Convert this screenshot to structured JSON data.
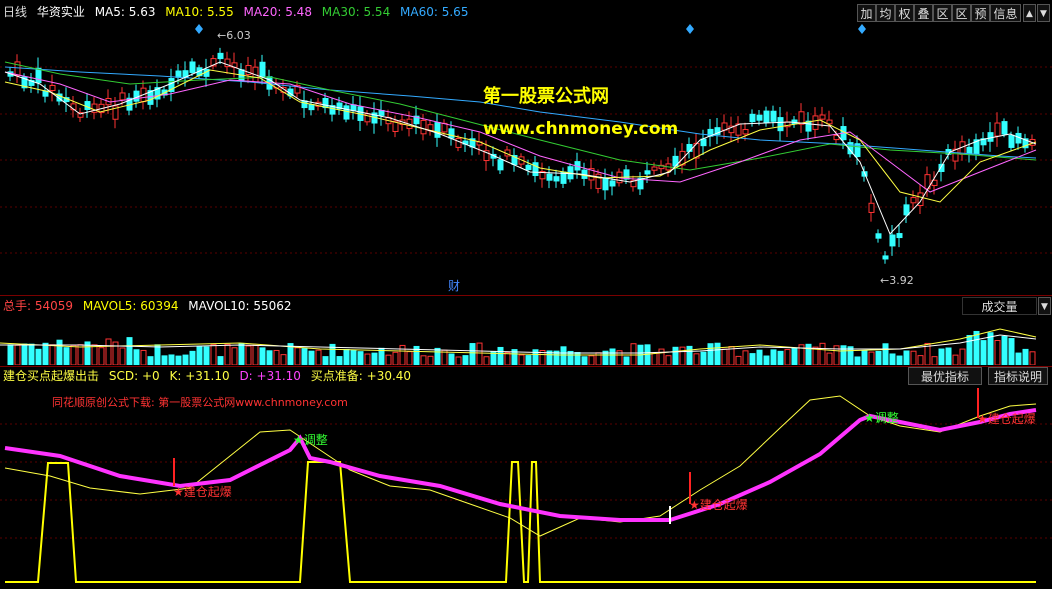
{
  "price_header": {
    "period": "日线",
    "stock": "华资实业",
    "ma5": "MA5: 5.63",
    "ma10": "MA10: 5.55",
    "ma20": "MA20: 5.48",
    "ma30": "MA30: 5.54",
    "ma60": "MA60: 5.65"
  },
  "toolbar": [
    "加",
    "均",
    "权",
    "叠",
    "区",
    "区",
    "预",
    "信息"
  ],
  "price_chart": {
    "high_label": "6.03",
    "low_label": "3.92",
    "finance_mark": "财",
    "watermark_title": "第一股票公式网",
    "watermark_url": "www.chnmoney.com"
  },
  "volume_header": {
    "total": "总手: 54059",
    "mavol5": "MAVOL5: 60394",
    "mavol10": "MAVOL10: 55062",
    "selector": "成交量"
  },
  "indicator_header": {
    "name": "建仓买点起爆出击",
    "scd": "SCD: +0",
    "k": "K: +31.10",
    "d": "D: +31.10",
    "ready": "买点准备: +30.40",
    "best_button": "最优指标",
    "help_button": "指标说明"
  },
  "indicator_chart": {
    "credit": "同花顺原创公式下载: 第一股票公式网www.chnmoney.com",
    "signal_adjust": "调整",
    "signal_burst": "建仓起爆"
  },
  "colors": {
    "ma5": "#ffffff",
    "ma10": "#ffff00",
    "ma20": "#ff66ff",
    "ma30": "#33cc33",
    "ma60": "#33aaff",
    "up": "#ff3333",
    "down": "#33ffff",
    "k": "#ffff44",
    "d": "#ff33ff"
  }
}
